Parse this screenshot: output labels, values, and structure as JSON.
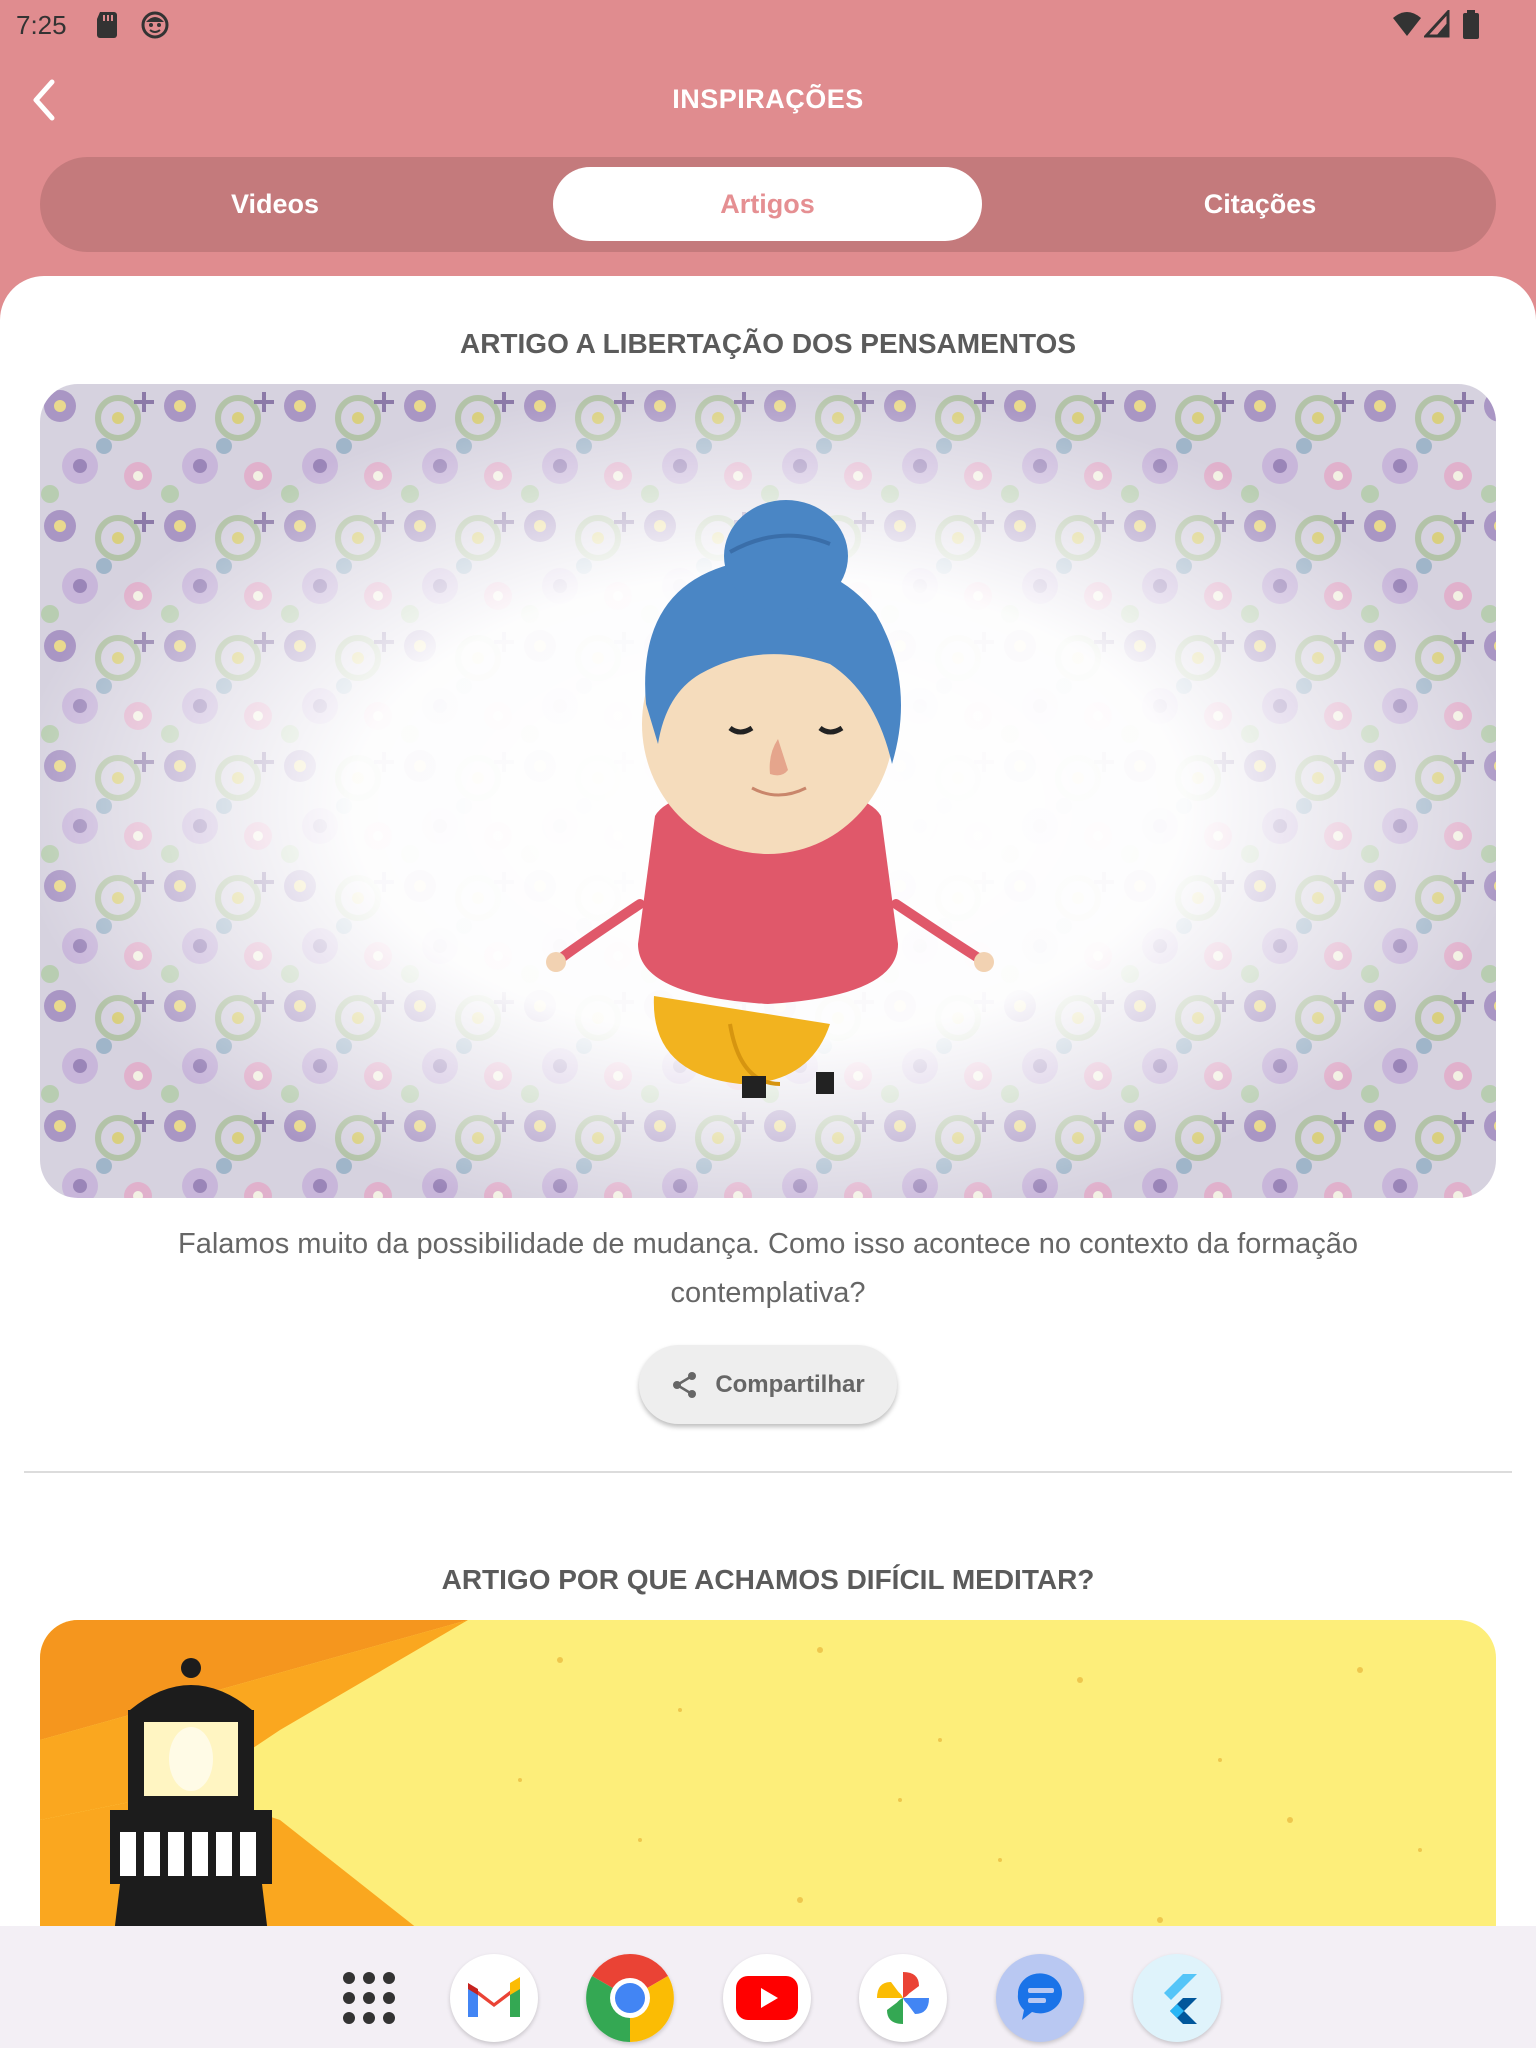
{
  "status_bar": {
    "time": "7:25"
  },
  "app_bar": {
    "title": "INSPIRAÇÕES"
  },
  "tabs": [
    {
      "label": "Videos",
      "active": false
    },
    {
      "label": "Artigos",
      "active": true
    },
    {
      "label": "Citações",
      "active": false
    }
  ],
  "articles": [
    {
      "title": "ARTIGO A LIBERTAÇÃO DOS PENSAMENTOS",
      "description": "Falamos muito da possibilidade de mudança. Como isso acontece no contexto da formação contemplativa?",
      "share_label": "Compartilhar",
      "image_icon": "meditating-woman-illustration"
    },
    {
      "title": "ARTIGO POR QUE ACHAMOS DIFÍCIL MEDITAR?",
      "image_icon": "lighthouse-illustration"
    }
  ],
  "dock": [
    {
      "name": "app-drawer",
      "icon": "grid-dots-icon"
    },
    {
      "name": "gmail",
      "icon": "gmail-icon"
    },
    {
      "name": "chrome",
      "icon": "chrome-icon"
    },
    {
      "name": "youtube",
      "icon": "youtube-icon"
    },
    {
      "name": "photos",
      "icon": "photos-icon"
    },
    {
      "name": "messages",
      "icon": "messages-icon"
    },
    {
      "name": "flutter",
      "icon": "flutter-icon"
    }
  ],
  "colors": {
    "header_bg": "#e08c8f",
    "tab_track": "#c47a7c",
    "active_tab_text": "#e58f92",
    "card_bg": "#ffffff"
  }
}
